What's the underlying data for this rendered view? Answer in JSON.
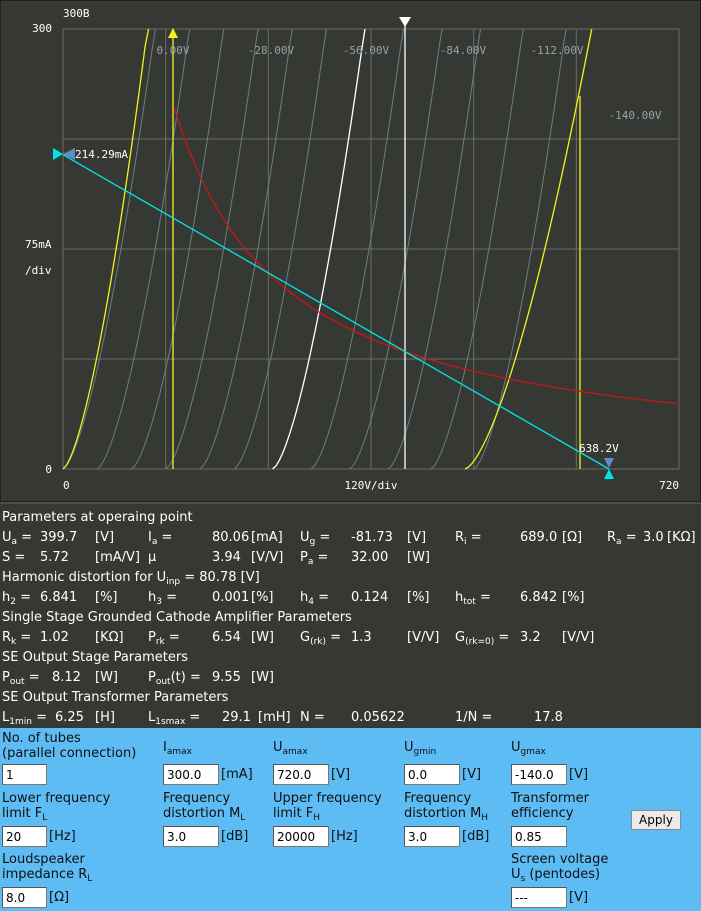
{
  "plot": {
    "tube_name": "300B",
    "y_max_label": "300",
    "y_zero_label": "0",
    "y_div_label": "75mA",
    "y_div_unit": "/div",
    "x_zero_label": "0",
    "x_div_label": "120V/div",
    "x_max_label": "720",
    "grid_curve_labels": [
      "0.00V",
      "-28.00V",
      "-56.00V",
      "-84.00V",
      "-112.00V",
      "-140.00V"
    ],
    "load_line_current_label": "214.29mA",
    "load_line_voltage_label": "638.2V",
    "colors": {
      "background": "#363933",
      "grid": "#6a6d66",
      "curves": "#6b7e87",
      "operating_curve": "#ffffff",
      "load_line": "#00e5e5",
      "power_hyperbola": "#c8161b",
      "limits": "#f2f21e"
    }
  },
  "params": {
    "header_operating": "Parameters at operaing point",
    "ua": {
      "label": "U",
      "sub": "a",
      "eq": "=",
      "value": "399.7",
      "unit": "[V]"
    },
    "ia": {
      "label": "I",
      "sub": "a",
      "eq": "=",
      "value": "80.06",
      "unit": "[mA]"
    },
    "ug": {
      "label": "U",
      "sub": "g",
      "eq": "=",
      "value": "-81.73",
      "unit": "[V]"
    },
    "ri": {
      "label": "R",
      "sub": "i",
      "eq": "=",
      "value": "689.0",
      "unit": "[Ω]"
    },
    "ra": {
      "label": "R",
      "sub": "a",
      "eq": "=",
      "value": "3.0",
      "unit": "[KΩ]"
    },
    "s": {
      "label": "S",
      "eq": "=",
      "value": "5.72",
      "unit": "[mA/V]"
    },
    "mu": {
      "label": "μ",
      "value": "3.94",
      "unit": "[V/V]"
    },
    "pa": {
      "label": "P",
      "sub": "a",
      "eq": "=",
      "value": "32.00",
      "unit": "[W]"
    },
    "header_harmonic": "Harmonic distortion for U",
    "header_harmonic_sub": "inp",
    "header_harmonic_value": "= 80.78 [V]",
    "h2": {
      "label": "h",
      "sub": "2",
      "eq": "=",
      "value": "6.841",
      "unit": "[%]"
    },
    "h3": {
      "label": "h",
      "sub": "3",
      "eq": "=",
      "value": "0.001",
      "unit": "[%]"
    },
    "h4": {
      "label": "h",
      "sub": "4",
      "eq": "=",
      "value": "0.124",
      "unit": "[%]"
    },
    "htot": {
      "label": "h",
      "sub": "tot",
      "eq": "=",
      "value": "6.842",
      "unit": "[%]"
    },
    "header_single": "Single Stage Grounded Cathode Amplifier Parameters",
    "rk": {
      "label": "R",
      "sub": "k",
      "eq": "=",
      "value": "1.02",
      "unit": "[KΩ]"
    },
    "prk": {
      "label": "P",
      "sub": "rk",
      "eq": "=",
      "value": "6.54",
      "unit": "[W]"
    },
    "grk": {
      "label": "G",
      "sub": "(rk)",
      "eq": "=",
      "value": "1.3",
      "unit": "[V/V]"
    },
    "grk0": {
      "label": "G",
      "sub": "(rk=0)",
      "eq": "=",
      "value": "3.2",
      "unit": "[V/V]"
    },
    "header_se_output": "SE Output Stage Parameters",
    "pout": {
      "label": "P",
      "sub": "out",
      "eq": "=",
      "value": "8.12",
      "unit": "[W]"
    },
    "poutt": {
      "label": "P",
      "sub": "out",
      "suffix": "(t)",
      "eq": "=",
      "value": "9.55",
      "unit": "[W]"
    },
    "header_transformer": "SE Output Transformer Parameters",
    "l1min": {
      "label": "L",
      "sub": "1min",
      "eq": "=",
      "value": "6.25",
      "unit": "[H]"
    },
    "l1smax": {
      "label": "L",
      "sub": "1smax",
      "eq": "=",
      "value": "29.1",
      "unit": "[mH]"
    },
    "n": {
      "label": "N",
      "eq": "=",
      "value": "0.05622"
    },
    "inv_n": {
      "label": "1/N",
      "eq": "=",
      "value": "17.8"
    }
  },
  "form": {
    "tubes": {
      "label1": "No. of tubes",
      "label2": "(parallel connection)",
      "value": "1"
    },
    "iamax": {
      "label": "I",
      "sub": "amax",
      "value": "300.0",
      "unit": "[mA]"
    },
    "uamax": {
      "label": "U",
      "sub": "amax",
      "value": "720.0",
      "unit": "[V]"
    },
    "ugmin": {
      "label": "U",
      "sub": "gmin",
      "value": "0.0",
      "unit": "[V]"
    },
    "ugmax": {
      "label": "U",
      "sub": "gmax",
      "value": "-140.0",
      "unit": "[V]"
    },
    "fl": {
      "label1": "Lower frequency",
      "label2": "limit F",
      "sub": "L",
      "value": "20",
      "unit": "[Hz]"
    },
    "ml": {
      "label1": "Frequency",
      "label2": "distortion M",
      "sub": "L",
      "value": "3.0",
      "unit": "[dB]"
    },
    "fh": {
      "label1": "Upper frequency",
      "label2": "limit F",
      "sub": "H",
      "value": "20000",
      "unit": "[Hz]"
    },
    "mh": {
      "label1": "Frequency",
      "label2": "distortion M",
      "sub": "H",
      "value": "3.0",
      "unit": "[dB]"
    },
    "eff": {
      "label1": "Transformer",
      "label2": "efficiency",
      "value": "0.85"
    },
    "apply_label": "Apply",
    "rl": {
      "label1": "Loudspeaker",
      "label2": "impedance R",
      "sub": "L",
      "value": "8.0",
      "unit": "[Ω]"
    },
    "us": {
      "label1": "Screen voltage",
      "label2": "U",
      "sub": "s",
      "label2b": " (pentodes)",
      "value": "---",
      "unit": "[V]"
    }
  }
}
